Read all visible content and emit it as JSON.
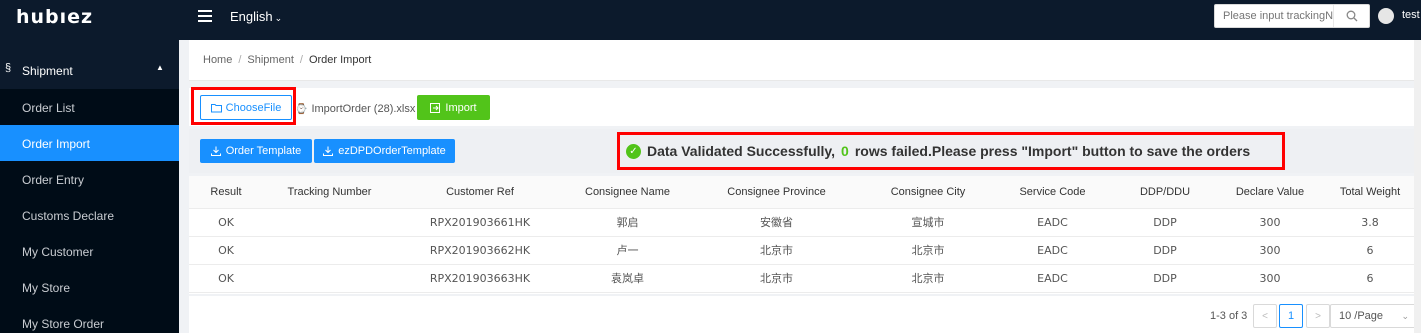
{
  "app": {
    "logo": "hubıez"
  },
  "header": {
    "language": "English",
    "search_placeholder": "Please input trackingNu",
    "user": "test"
  },
  "sidebar": {
    "group": "Shipment",
    "items": [
      {
        "label": "Order List"
      },
      {
        "label": "Order Import",
        "active": true
      },
      {
        "label": "Order Entry"
      },
      {
        "label": "Customs Declare"
      },
      {
        "label": "My Customer"
      },
      {
        "label": "My Store"
      },
      {
        "label": "My Store Order"
      }
    ]
  },
  "breadcrumb": {
    "home": "Home",
    "section": "Shipment",
    "current": "Order Import"
  },
  "upload": {
    "choose_label": "ChooseFile",
    "file_name": "ImportOrder (28).xlsx",
    "import_label": "Import"
  },
  "toolbar": {
    "order_template": "Order Template",
    "dpd_template": "ezDPDOrderTemplate"
  },
  "message": {
    "prefix": "Data Validated Successfully,",
    "failed_count": "0",
    "suffix": "rows failed.Please press \"Import\" button to save the orders"
  },
  "table": {
    "columns": [
      "Result",
      "Tracking Number",
      "Customer Ref",
      "Consignee Name",
      "Consignee Province",
      "Consignee City",
      "Service Code",
      "DDP/DDU",
      "Declare Value",
      "Total Weight"
    ],
    "rows": [
      [
        "OK",
        "",
        "RPX201903661HK",
        "郭启",
        "安徽省",
        "宣城市",
        "EADC",
        "DDP",
        "300",
        "3.8"
      ],
      [
        "OK",
        "",
        "RPX201903662HK",
        "卢一",
        "北京市",
        "北京市",
        "EADC",
        "DDP",
        "300",
        "6"
      ],
      [
        "OK",
        "",
        "RPX201903663HK",
        "袁岚卓",
        "北京市",
        "北京市",
        "EADC",
        "DDP",
        "300",
        "6"
      ]
    ]
  },
  "pagination": {
    "total_text": "1-3 of 3",
    "current_page": "1",
    "page_size": "10 /Page"
  }
}
